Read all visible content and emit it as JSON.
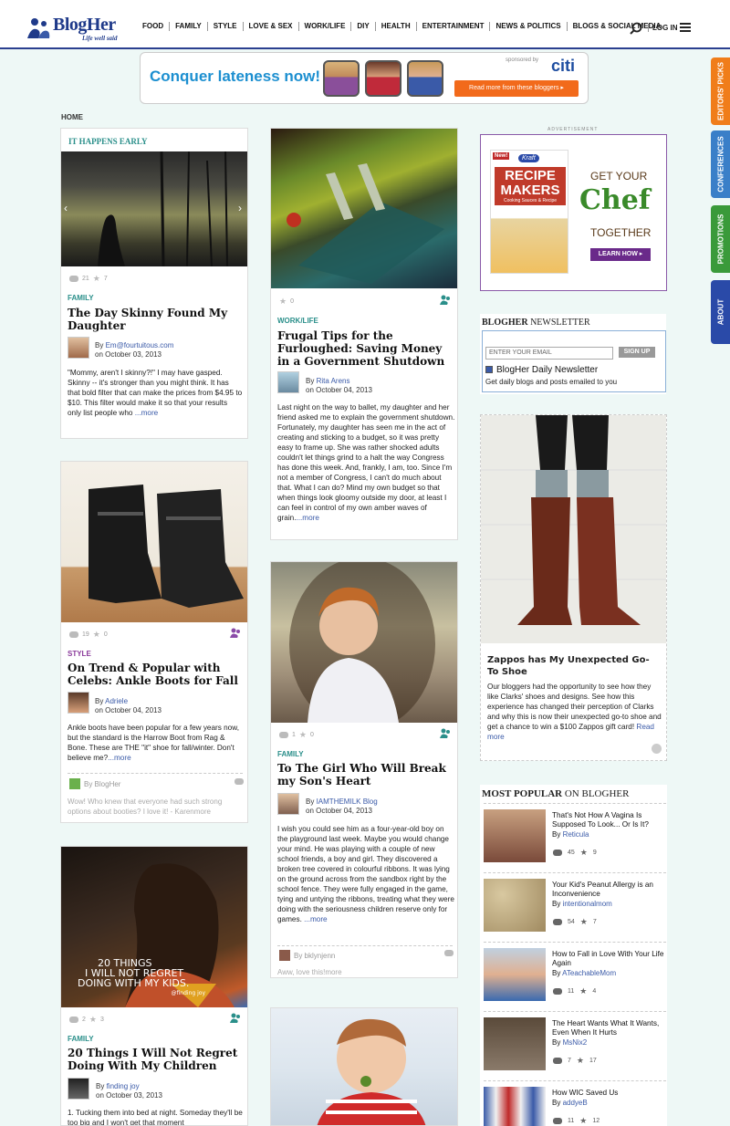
{
  "header": {
    "logo_text": "BlogHer",
    "logo_tagline": "Life well said",
    "nav": [
      "FOOD",
      "FAMILY",
      "STYLE",
      "LOVE & SEX",
      "WORK/LIFE",
      "DIY",
      "HEALTH",
      "ENTERTAINMENT",
      "NEWS & POLITICS",
      "BLOGS & SOCIAL MEDIA"
    ],
    "login": "LOG IN"
  },
  "banner": {
    "title": "Conquer lateness now!",
    "sponsor": "sponsored by",
    "sponsor_brand": "citi",
    "button": "Read more from these bloggers ▸"
  },
  "breadcrumb": "HOME",
  "side_tabs": [
    "EDITORS' PICKS",
    "CONFERENCES",
    "PROMOTIONS",
    "ABOUT"
  ],
  "colors": {
    "brand": "#1f3a8a",
    "teal": "#2a8f8a",
    "link": "#3a5aa8",
    "tab_orange": "#f07d1a",
    "tab_blue": "#3a7fc8",
    "tab_green": "#3a9a3a",
    "tab_navy": "#2a4aa8"
  },
  "cards": {
    "c1": {
      "header": "IT HAPPENS EARLY",
      "comments": "21",
      "stars": "7",
      "category": "FAMILY",
      "title": "The Day Skinny Found My Daughter",
      "by_label": "By",
      "author": "Em@fourtuitous.com",
      "date": "on October 03, 2013",
      "excerpt": "\"Mommy, aren't I skinny?!\" I may have gasped. Skinny -- it's stronger than you might think. It has that bold filter that can make the prices from $4.95 to $10. This filter would make it so that your results only list people who",
      "more": " ...more"
    },
    "c2": {
      "comments": "0",
      "category": "WORK/LIFE",
      "title": "Frugal Tips for the Furloughed: Saving Money in a Government Shutdown",
      "by_label": "By",
      "author": "Rita Arens",
      "date": "on October 04, 2013",
      "excerpt": "Last night on the way to ballet, my daughter and her friend asked me to explain the government shutdown. Fortunately, my daughter has seen me in the act of creating and sticking to a budget, so it was pretty easy to frame up. She was rather shocked adults couldn't let things grind to a halt the way Congress has done this week. And, frankly, I am, too. Since I'm not a member of Congress, I can't do much about that. What I can do? Mind my own budget so that when things look gloomy outside my door, at least I can feel in control of my own amber waves of grain.",
      "more": "...more"
    },
    "c3": {
      "comments": "19",
      "stars": "0",
      "category": "STYLE",
      "title": "On Trend & Popular with Celebs: Ankle Boots for Fall",
      "by_label": "By",
      "author": "Adriele",
      "date": "on October 04, 2013",
      "excerpt": "Ankle boots have been popular for a few years now, but the standard is the Harrow Boot from Rag & Bone. These are THE \"it\" shoe for fall/winter. Don't believe me?",
      "more": "...more",
      "comment_by": "By BlogHer",
      "comment_text": "Wow! Who knew that everyone had such strong options about booties? I love it! - Karenmore"
    },
    "c4": {
      "comments": "1",
      "stars": "0",
      "category": "FAMILY",
      "title": "To The Girl Who Will Break my Son's Heart",
      "by_label": "By",
      "author": "IAMTHEMILK Blog",
      "date": "on October 04, 2013",
      "excerpt": "I wish you could see him as a four-year-old boy on the playground last week. Maybe you would change your mind. He was playing with a couple of new school friends, a boy and girl. They discovered a broken tree covered in colourful ribbons. It was lying on the ground across from the sandbox right by the school fence. They were fully engaged in the game, tying and untying the ribbons, treating what they were doing with the seriousness children reserve only for games.",
      "more": " ...more",
      "comment_by": "By bklynjenn",
      "comment_text": "Aww, love this!more"
    },
    "c5": {
      "image_text_line1": "20 THINGS",
      "image_text_line2": "I WILL NOT REGRET",
      "image_text_line3": "DOING WITH MY KIDS.",
      "image_text_sig": "@finding joy",
      "comments": "2",
      "stars": "3",
      "category": "FAMILY",
      "title": "20 Things I Will Not Regret Doing With My Children",
      "by_label": "By",
      "author": "finding joy",
      "date": "on October 03, 2013",
      "excerpt": "1. Tucking them into bed at night. Someday they'll be too big and I won't get that moment"
    }
  },
  "right": {
    "ad_label": "ADVERTISEMENT",
    "kraft": {
      "brand": "Kraft",
      "new": "New!",
      "product_line1": "RECIPE",
      "product_line2": "MAKERS",
      "product_sub": "Cooking Sauces & Recipe",
      "headline1": "GET YOUR",
      "headline2": "Chef",
      "headline3": "TOGETHER",
      "cta": "LEARN HOW ▸"
    },
    "newsletter": {
      "title_bold": "BLOGHER",
      "title_rest": " NEWSLETTER",
      "placeholder": "ENTER YOUR EMAIL",
      "button": "SIGN UP",
      "check_label": "BlogHer Daily Newsletter",
      "desc": "Get daily blogs and posts emailed to you"
    },
    "zappos": {
      "title": "Zappos has My Unexpected Go-To Shoe",
      "text": "Our bloggers had the opportunity to see how they like Clarks' shoes and designs. See how this experience has changed their perception of Clarks and why this is now their unexpected go-to shoe and get a chance to win a $100 Zappos gift card!",
      "more": " Read more"
    },
    "popular": {
      "title_bold": "MOST POPULAR",
      "title_rest": " ON BLOGHER",
      "items": [
        {
          "title": "That's Not How A Vagina Is Supposed To Look... Or Is It?",
          "by": "By",
          "author": "Reticula",
          "comments": "45",
          "stars": "9"
        },
        {
          "title": "Your Kid's Peanut Allergy is an Inconvenience",
          "by": "By",
          "author": "intentionalmom",
          "comments": "54",
          "stars": "7"
        },
        {
          "title": "How to Fall in Love With Your Life Again",
          "by": "By",
          "author": "ATeachableMom",
          "comments": "11",
          "stars": "4"
        },
        {
          "title": "The Heart Wants What It Wants, Even When It Hurts",
          "by": "By",
          "author": "MsNix2",
          "comments": "7",
          "stars": "17"
        },
        {
          "title": "How WIC Saved Us",
          "by": "By",
          "author": "addyeB",
          "comments": "11",
          "stars": "12"
        }
      ]
    }
  }
}
